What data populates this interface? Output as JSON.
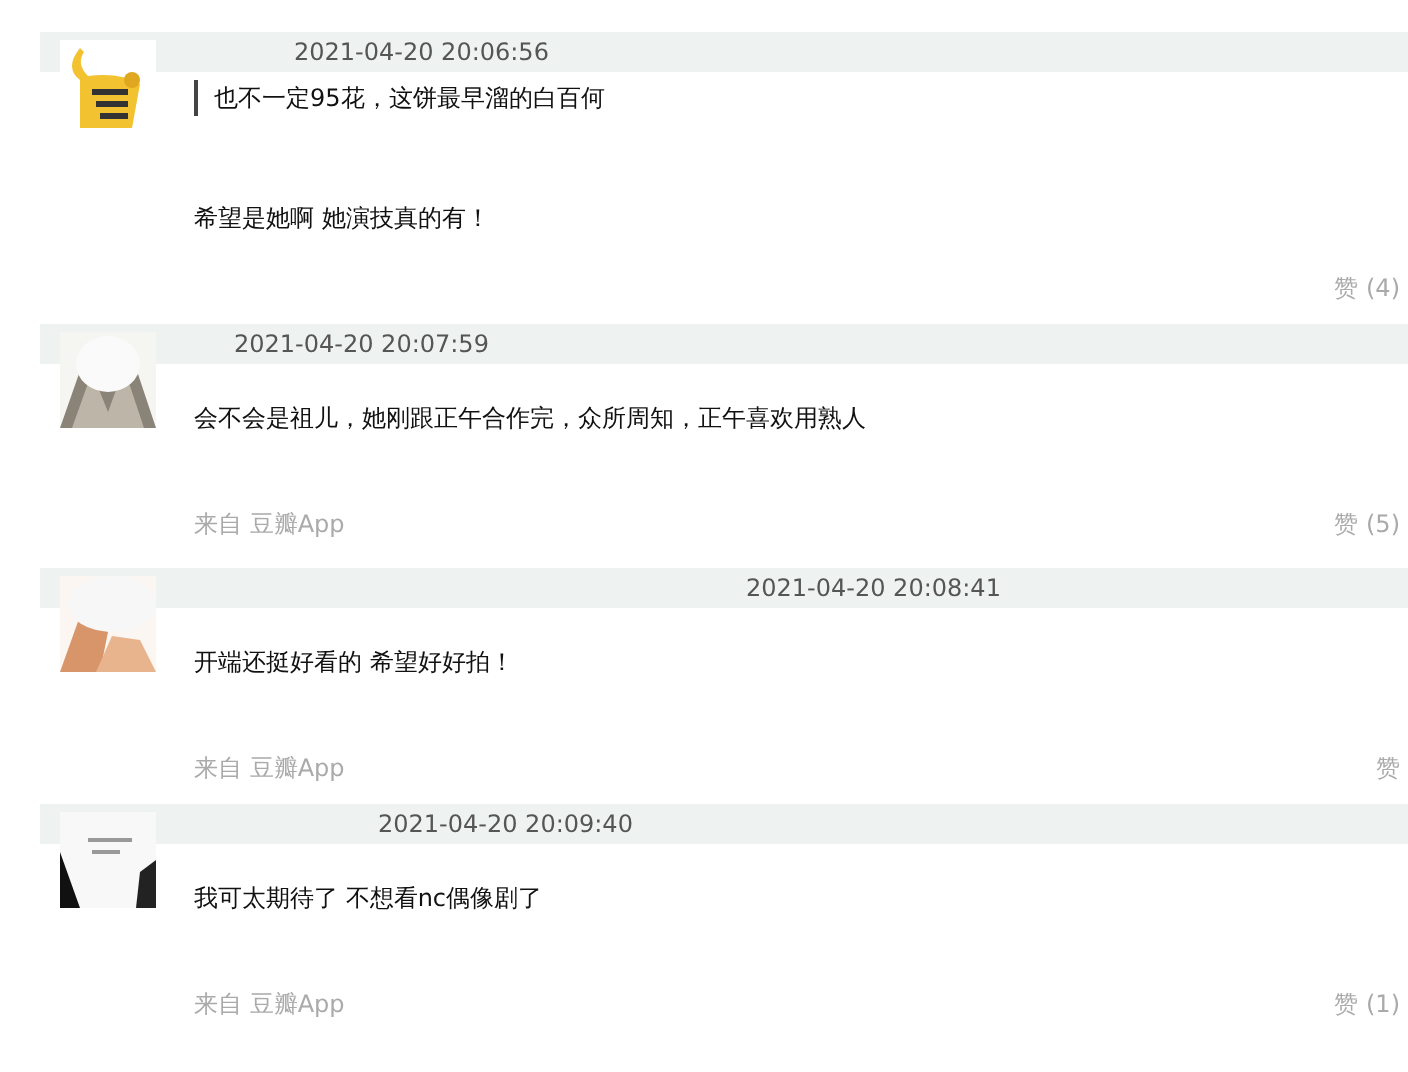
{
  "comments": [
    {
      "time": "2021-04-20 20:06:56",
      "quote": "也不一定95花，这饼最早溜的白百何",
      "text": "希望是她啊 她演技真的有！",
      "likes": "赞 (4)"
    },
    {
      "time": "2021-04-20 20:07:59",
      "text": "会不会是祖儿，她刚跟正午合作完，众所周知，正午喜欢用熟人",
      "source": "来自 豆瓣App",
      "likes": "赞 (5)"
    },
    {
      "time": "2021-04-20 20:08:41",
      "text": "开端还挺好看的 希望好好拍！",
      "source": "来自 豆瓣App",
      "likes": "赞"
    },
    {
      "time": "2021-04-20 20:09:40",
      "text": "我可太期待了 不想看nc偶像剧了",
      "source": "来自 豆瓣App",
      "likes": "赞 (1)"
    }
  ]
}
